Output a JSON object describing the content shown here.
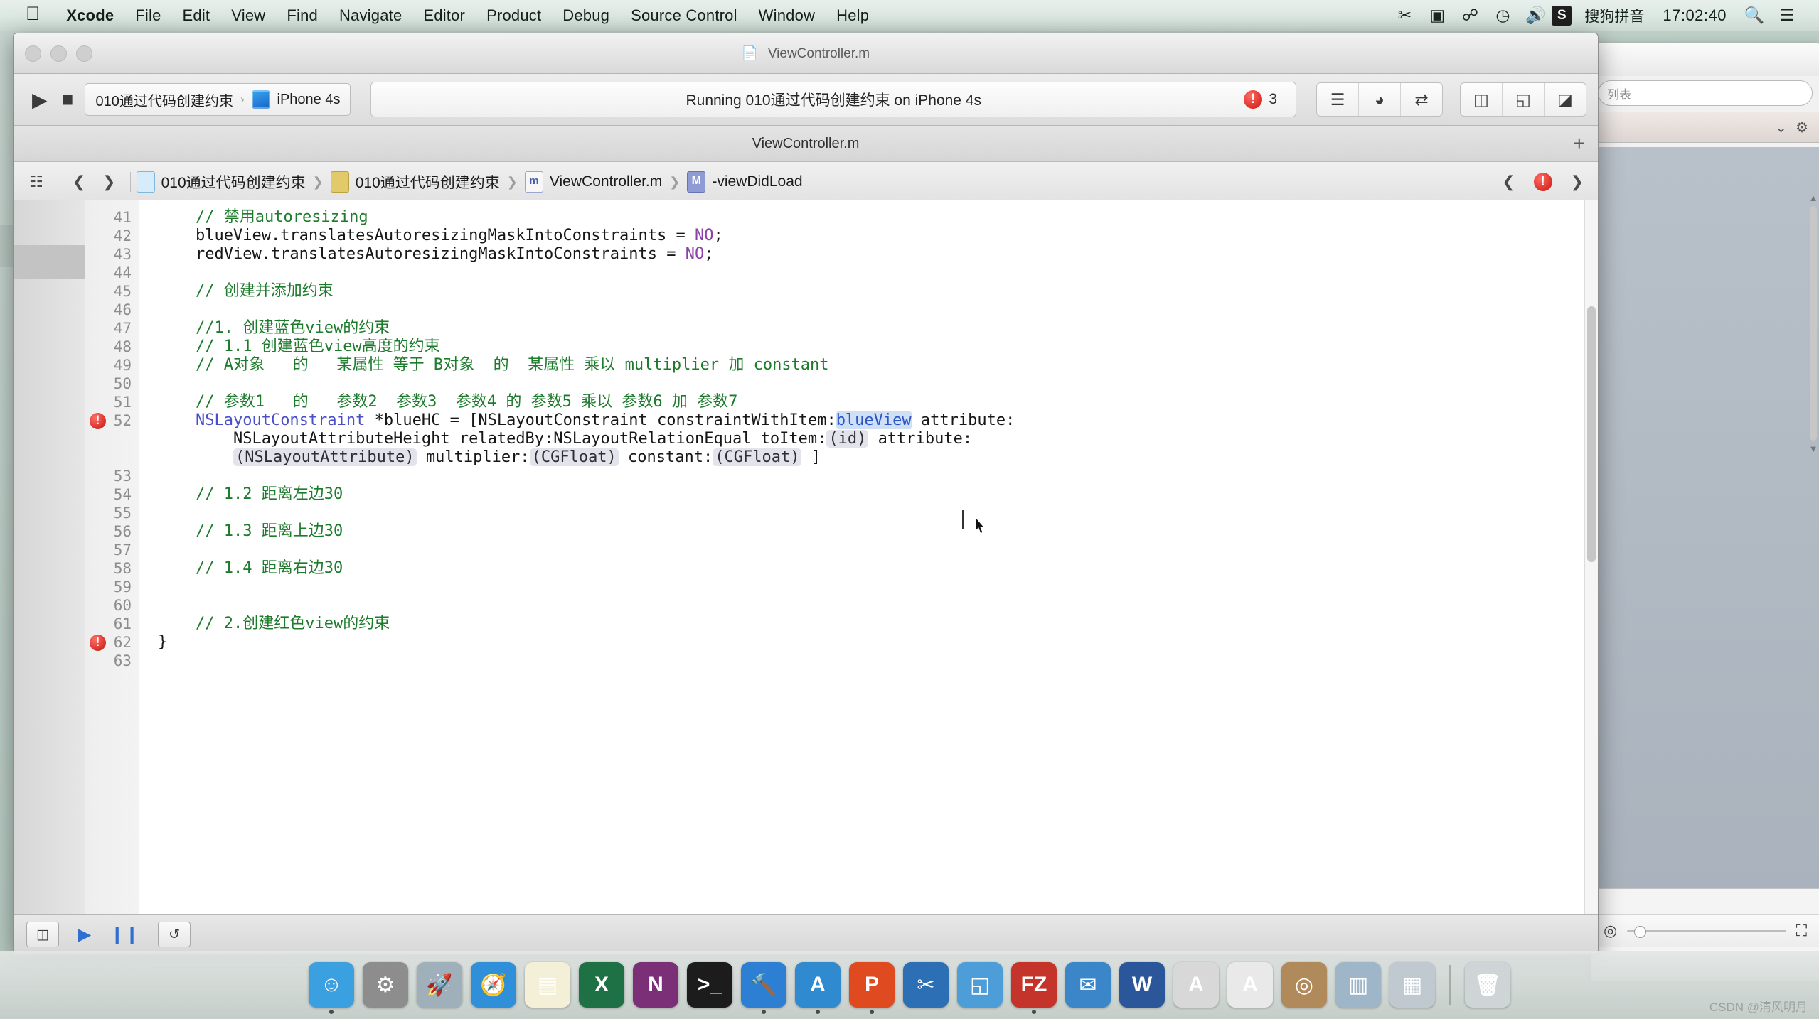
{
  "menubar": {
    "apple_icon": "apple-logo",
    "items": [
      {
        "label": "Xcode",
        "bold": true
      },
      {
        "label": "File",
        "bold": false
      },
      {
        "label": "Edit",
        "bold": false
      },
      {
        "label": "View",
        "bold": false
      },
      {
        "label": "Find",
        "bold": false
      },
      {
        "label": "Navigate",
        "bold": false
      },
      {
        "label": "Editor",
        "bold": false
      },
      {
        "label": "Product",
        "bold": false
      },
      {
        "label": "Debug",
        "bold": false
      },
      {
        "label": "Source Control",
        "bold": false
      },
      {
        "label": "Window",
        "bold": false
      },
      {
        "label": "Help",
        "bold": false
      }
    ],
    "right": {
      "icons": [
        "scissors-icon",
        "screen-record-icon",
        "bluetooth-icon",
        "clock-icon",
        "volume-icon"
      ],
      "input_badge": "S",
      "input_method": "搜狗拼音",
      "clock": "17:02:40",
      "search_icon": "search-icon",
      "list_icon": "notification-center-icon"
    }
  },
  "xcode_window": {
    "title": "ViewController.m",
    "title_icon": "document-icon",
    "add_tab_label": "+",
    "toolbar": {
      "run_icon": "play-icon",
      "stop_icon": "stop-icon",
      "scheme_project": "010通过代码创建约束",
      "scheme_separator": "›",
      "scheme_device": "iPhone 4s",
      "status_text": "Running 010通过代码创建约束 on iPhone 4s",
      "issue_badge": "!",
      "issue_count": "3",
      "editor_buttons": [
        "standard-editor-icon",
        "assistant-editor-icon",
        "version-editor-icon"
      ],
      "view_buttons": [
        "navigator-toggle-icon",
        "debug-area-toggle-icon",
        "utilities-toggle-icon"
      ]
    },
    "jumpbar": {
      "related_icon": "related-items-icon",
      "back_icon": "chevron-left-icon",
      "forward_icon": "chevron-right-icon",
      "crumbs": [
        {
          "icon": "project-icon",
          "label": "010通过代码创建约束"
        },
        {
          "icon": "folder-icon",
          "label": "010通过代码创建约束"
        },
        {
          "icon": "m-file-icon",
          "label": "ViewController.m"
        },
        {
          "icon": "method-icon",
          "label": "-viewDidLoad"
        }
      ],
      "right_prev_icon": "chevron-left-icon",
      "right_issue_badge": "!",
      "right_next_icon": "chevron-right-icon"
    },
    "footer": {
      "buttons": [
        "hide-navigator-icon",
        "continue-icon",
        "pause-icon",
        "step-over-icon"
      ]
    }
  },
  "code": {
    "lines": [
      {
        "num": "41",
        "error": false,
        "segments": [
          {
            "t": "    ",
            "c": "pln"
          },
          {
            "t": "// 禁用autoresizing",
            "c": "cmt"
          }
        ]
      },
      {
        "num": "42",
        "error": false,
        "segments": [
          {
            "t": "    blueView.translatesAutoresizingMaskIntoConstraints = ",
            "c": "pln"
          },
          {
            "t": "NO",
            "c": "kw"
          },
          {
            "t": ";",
            "c": "pln"
          }
        ]
      },
      {
        "num": "43",
        "error": false,
        "segments": [
          {
            "t": "    redView.translatesAutoresizingMaskIntoConstraints = ",
            "c": "pln"
          },
          {
            "t": "NO",
            "c": "kw"
          },
          {
            "t": ";",
            "c": "pln"
          }
        ]
      },
      {
        "num": "44",
        "error": false,
        "segments": []
      },
      {
        "num": "45",
        "error": false,
        "segments": [
          {
            "t": "    ",
            "c": "pln"
          },
          {
            "t": "// 创建并添加约束",
            "c": "cmt"
          }
        ]
      },
      {
        "num": "46",
        "error": false,
        "segments": []
      },
      {
        "num": "47",
        "error": false,
        "segments": [
          {
            "t": "    ",
            "c": "pln"
          },
          {
            "t": "//1. 创建蓝色view的约束",
            "c": "cmt"
          }
        ]
      },
      {
        "num": "48",
        "error": false,
        "segments": [
          {
            "t": "    ",
            "c": "pln"
          },
          {
            "t": "// 1.1 创建蓝色view高度的约束",
            "c": "cmt"
          }
        ]
      },
      {
        "num": "49",
        "error": false,
        "segments": [
          {
            "t": "    ",
            "c": "pln"
          },
          {
            "t": "// A对象   的   某属性 等于 B对象  的  某属性 乘以 multiplier 加 constant",
            "c": "cmt"
          }
        ]
      },
      {
        "num": "50",
        "error": false,
        "segments": []
      },
      {
        "num": "51",
        "error": false,
        "segments": [
          {
            "t": "    ",
            "c": "pln"
          },
          {
            "t": "// 参数1   的   参数2  参数3  参数4 的 参数5 乘以 参数6 加 参数7",
            "c": "cmt"
          }
        ]
      }
    ],
    "statement": {
      "num": "52",
      "error": true,
      "row1": [
        {
          "t": "    ",
          "c": "pln"
        },
        {
          "t": "NSLayoutConstraint",
          "c": "cls"
        },
        {
          "t": " *blueHC = [",
          "c": "pln"
        },
        {
          "t": "NSLayoutConstraint",
          "c": "pln"
        },
        {
          "t": " constraintWithItem:",
          "c": "pln"
        },
        {
          "t": "blueView",
          "c": "selid"
        },
        {
          "t": " attribute:",
          "c": "pln"
        }
      ],
      "row2": [
        {
          "t": "        NSLayoutAttributeHeight relatedBy:NSLayoutRelationEqual toItem:",
          "c": "pln"
        },
        {
          "t": "(id)",
          "c": "tok"
        },
        {
          "t": " attribute:",
          "c": "pln"
        }
      ],
      "row3": [
        {
          "t": "        ",
          "c": "pln"
        },
        {
          "t": "(NSLayoutAttribute)",
          "c": "tok"
        },
        {
          "t": " multiplier:",
          "c": "pln"
        },
        {
          "t": "(CGFloat)",
          "c": "tok"
        },
        {
          "t": " constant:",
          "c": "pln"
        },
        {
          "t": "(CGFloat)",
          "c": "tok"
        },
        {
          "t": " ]",
          "c": "pln"
        }
      ]
    },
    "lines_after": [
      {
        "num": "53",
        "error": false,
        "segments": []
      },
      {
        "num": "54",
        "error": false,
        "segments": [
          {
            "t": "    ",
            "c": "pln"
          },
          {
            "t": "// 1.2 距离左边30",
            "c": "cmt"
          }
        ]
      },
      {
        "num": "55",
        "error": false,
        "segments": []
      },
      {
        "num": "56",
        "error": false,
        "segments": [
          {
            "t": "    ",
            "c": "pln"
          },
          {
            "t": "// 1.3 距离上边30",
            "c": "cmt"
          }
        ]
      },
      {
        "num": "57",
        "error": false,
        "segments": []
      },
      {
        "num": "58",
        "error": false,
        "segments": [
          {
            "t": "    ",
            "c": "pln"
          },
          {
            "t": "// 1.4 距离右边30",
            "c": "cmt"
          }
        ]
      },
      {
        "num": "59",
        "error": false,
        "segments": []
      },
      {
        "num": "60",
        "error": false,
        "segments": []
      },
      {
        "num": "61",
        "error": false,
        "segments": [
          {
            "t": "    ",
            "c": "pln"
          },
          {
            "t": "// 2.创建红色view的约束",
            "c": "cmt"
          }
        ]
      },
      {
        "num": "62",
        "error": true,
        "segments": [
          {
            "t": "}",
            "c": "pln"
          }
        ]
      },
      {
        "num": "63",
        "error": false,
        "segments": []
      }
    ]
  },
  "background_window": {
    "search_placeholder": "列表",
    "chevron_icon": "chevron-down-icon",
    "gear_icon": "gear-icon",
    "expand_icon": "expand-icon",
    "scroll_up_icon": "triangle-up-icon",
    "scroll_down_icon": "triangle-down-icon"
  },
  "dock": {
    "items": [
      {
        "name": "finder",
        "glyph": "☺",
        "color": "#3aa0e0",
        "running": true
      },
      {
        "name": "system-preferences",
        "glyph": "⚙",
        "color": "#8d8d8d",
        "running": false
      },
      {
        "name": "launchpad",
        "glyph": "🚀",
        "color": "#9fb0bb",
        "running": false
      },
      {
        "name": "safari",
        "glyph": "🧭",
        "color": "#2f8fd8",
        "running": false
      },
      {
        "name": "stickies",
        "glyph": "▤",
        "color": "#f4f0d8",
        "running": false
      },
      {
        "name": "excel",
        "glyph": "X",
        "color": "#1e7145",
        "running": false
      },
      {
        "name": "onenote",
        "glyph": "N",
        "color": "#7a2f77",
        "running": false
      },
      {
        "name": "terminal",
        "glyph": ">_",
        "color": "#1c1c1c",
        "running": false
      },
      {
        "name": "xcode",
        "glyph": "🔨",
        "color": "#2d7fd3",
        "running": true
      },
      {
        "name": "app-store",
        "glyph": "A",
        "color": "#2f8ad0",
        "running": true
      },
      {
        "name": "parallels",
        "glyph": "P",
        "color": "#e04a20",
        "running": true
      },
      {
        "name": "scissors-app",
        "glyph": "✂",
        "color": "#2c6fb5",
        "running": false
      },
      {
        "name": "preview",
        "glyph": "◱",
        "color": "#4c9dd8",
        "running": false
      },
      {
        "name": "filezilla",
        "glyph": "FZ",
        "color": "#c4342a",
        "running": true
      },
      {
        "name": "mail",
        "glyph": "✉",
        "color": "#3a86c8",
        "running": false
      },
      {
        "name": "word",
        "glyph": "W",
        "color": "#2b579a",
        "running": false
      },
      {
        "name": "font-book",
        "glyph": "A",
        "color": "#d8d8d8",
        "running": false
      },
      {
        "name": "text-app",
        "glyph": "A",
        "color": "#e9e9e9",
        "running": false
      },
      {
        "name": "contacts",
        "glyph": "◎",
        "color": "#b08a5a",
        "running": false
      },
      {
        "name": "downloads-stack",
        "glyph": "▥",
        "color": "#9fb6c8",
        "running": false
      },
      {
        "name": "documents-stack",
        "glyph": "▦",
        "color": "#c0c8d0",
        "running": false
      },
      {
        "name": "trash",
        "glyph": "🗑",
        "color": "#cfd4d6",
        "running": false
      }
    ]
  },
  "watermark": "CSDN @清风明月"
}
